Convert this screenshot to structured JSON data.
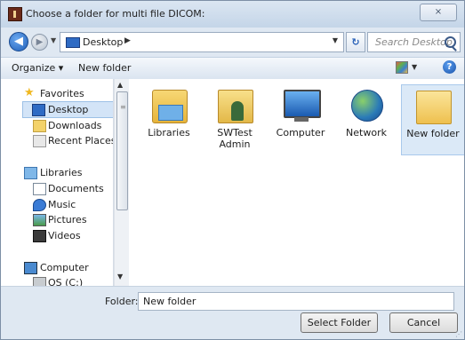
{
  "window": {
    "title": "Choose a folder for multi file DICOM:",
    "close_glyph": "⨯"
  },
  "address": {
    "location": "Desktop",
    "search_placeholder": "Search Desktop"
  },
  "commandbar": {
    "organize": "Organize ▾",
    "new_folder": "New folder"
  },
  "nav": {
    "favorites": "Favorites",
    "desktop": "Desktop",
    "downloads": "Downloads",
    "recent": "Recent Places",
    "libraries": "Libraries",
    "documents": "Documents",
    "music": "Music",
    "pictures": "Pictures",
    "videos": "Videos",
    "computer": "Computer",
    "os": "OS (C:)"
  },
  "content": {
    "items": [
      {
        "label": "Libraries"
      },
      {
        "label": "SWTest Admin"
      },
      {
        "label": "Computer"
      },
      {
        "label": "Network"
      },
      {
        "label": "New folder"
      }
    ]
  },
  "bottom": {
    "folder_label": "Folder:",
    "folder_value": "New folder",
    "select_button": "Select Folder",
    "cancel_button": "Cancel"
  },
  "icons": [
    "back-arrow-icon",
    "forward-arrow-icon",
    "refresh-icon",
    "search-icon",
    "views-icon",
    "help-icon",
    "folder-icon",
    "computer-icon",
    "network-icon",
    "star-icon"
  ]
}
